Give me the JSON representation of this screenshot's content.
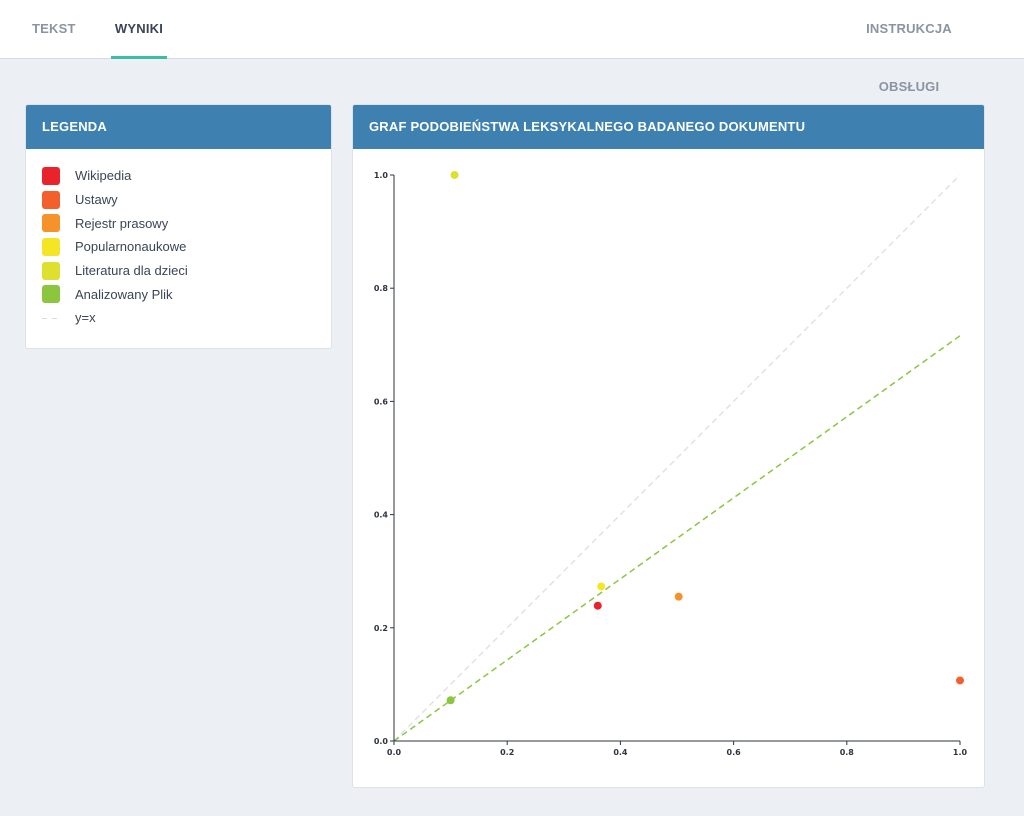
{
  "nav": {
    "tabs": [
      {
        "label": "TEKST",
        "active": false
      },
      {
        "label": "WYNIKI",
        "active": true
      }
    ],
    "help": "INSTRUKCJA OBSŁUGI",
    "accent_color": "#38bfa4"
  },
  "legend": {
    "title": "LEGENDA",
    "items": [
      {
        "label": "Wikipedia",
        "color": "#e8232b"
      },
      {
        "label": "Ustawy",
        "color": "#f2602e"
      },
      {
        "label": "Rejestr prasowy",
        "color": "#f5922a"
      },
      {
        "label": "Popularnonaukowe",
        "color": "#f5e625"
      },
      {
        "label": "Literatura dla dzieci",
        "color": "#dde02e"
      },
      {
        "label": "Analizowany Plik",
        "color": "#8cc63f"
      },
      {
        "label": "y=x",
        "color": "#d9dce0",
        "style": "dashed"
      }
    ]
  },
  "graph": {
    "title": "GRAF PODOBIEŃSTWA LEKSYKALNEGO BADANEGO DOKUMENTU",
    "header_color": "#3e81b0"
  },
  "chart_data": {
    "type": "scatter",
    "xlim": [
      0,
      1
    ],
    "ylim": [
      0,
      1
    ],
    "x_ticks": [
      "0.0",
      "0.2",
      "0.4",
      "0.6",
      "0.8",
      "1.0"
    ],
    "y_ticks": [
      "0.0",
      "0.2",
      "0.4",
      "0.6",
      "0.8",
      "1.0"
    ],
    "points": [
      {
        "series": "Literatura dla dzieci",
        "x": 0.107,
        "y": 1.0,
        "color": "#dde02e"
      },
      {
        "series": "Popularnonaukowe",
        "x": 0.366,
        "y": 0.273,
        "color": "#f5e625"
      },
      {
        "series": "Wikipedia",
        "x": 0.36,
        "y": 0.239,
        "color": "#e8232b"
      },
      {
        "series": "Rejestr prasowy",
        "x": 0.503,
        "y": 0.255,
        "color": "#f5922a"
      },
      {
        "series": "Ustawy",
        "x": 1.0,
        "y": 0.107,
        "color": "#f2602e"
      },
      {
        "series": "Analizowany Plik",
        "x": 0.1,
        "y": 0.072,
        "color": "#8cc63f"
      }
    ],
    "lines": [
      {
        "name": "y=x",
        "points": [
          [
            0,
            0
          ],
          [
            1,
            1
          ]
        ],
        "color": "#dfe2e6",
        "style": "dashed"
      },
      {
        "name": "Analizowany Plik",
        "points": [
          [
            0,
            0
          ],
          [
            1,
            0.716
          ]
        ],
        "color": "#8cc63f",
        "style": "dashed"
      }
    ],
    "grid": false
  }
}
